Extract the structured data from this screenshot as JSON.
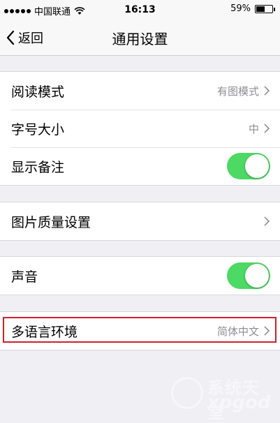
{
  "status_bar": {
    "carrier": "中国联通",
    "time": "16:13",
    "battery_percent": "59%",
    "battery_level": 0.59,
    "signal_dots": 5
  },
  "nav": {
    "back_label": "返回",
    "title": "通用设置"
  },
  "groups": [
    {
      "rows": [
        {
          "label": "阅读模式",
          "value": "有图模式",
          "control": "chevron"
        },
        {
          "label": "字号大小",
          "value": "中",
          "control": "chevron"
        },
        {
          "label": "显示备注",
          "control": "toggle",
          "on": true
        }
      ]
    },
    {
      "rows": [
        {
          "label": "图片质量设置",
          "value": "",
          "control": "chevron"
        }
      ]
    },
    {
      "rows": [
        {
          "label": "声音",
          "control": "toggle",
          "on": true
        }
      ]
    },
    {
      "rows": [
        {
          "label": "多语言环境",
          "value": "简体中文",
          "control": "chevron"
        }
      ]
    }
  ],
  "colors": {
    "toggle_on": "#4cd964",
    "highlight_border": "#d0202a",
    "background": "#efeff4"
  },
  "watermark": {
    "line1": "系统天堂",
    "line2": "xpgod"
  }
}
